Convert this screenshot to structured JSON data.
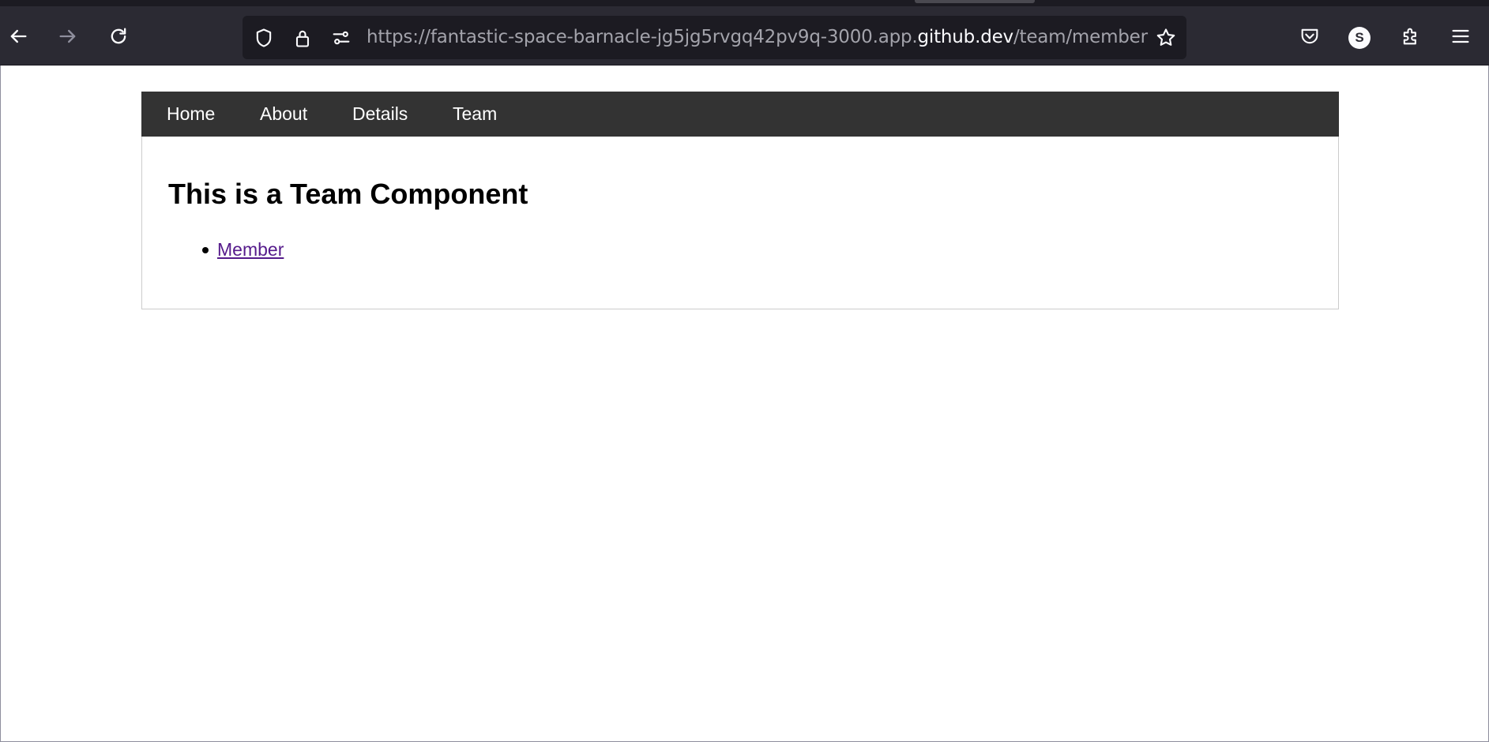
{
  "browser": {
    "url_prefix": "https://fantastic-space-barnacle-jg5jg5rvgq42pv9q-3000.app.",
    "url_domain": "github.dev",
    "url_path": "/team/member",
    "profile_initial": "S",
    "icons": {
      "back": "back-arrow-icon",
      "forward": "forward-arrow-icon",
      "reload": "reload-icon",
      "shield": "tracking-protection-shield-icon",
      "lock": "lock-icon",
      "permissions": "permissions-sliders-icon",
      "bookmark": "star-bookmark-icon",
      "pocket": "pocket-icon",
      "extensions": "puzzle-extensions-icon",
      "menu": "hamburger-menu-icon"
    }
  },
  "nav": {
    "items": [
      {
        "label": "Home"
      },
      {
        "label": "About"
      },
      {
        "label": "Details"
      },
      {
        "label": "Team"
      }
    ]
  },
  "main": {
    "title": "This is a Team Component",
    "members": [
      {
        "label": "Member"
      }
    ]
  },
  "colors": {
    "nav_bg": "#333333",
    "visited_link": "#551a8b",
    "toolbar_bg": "#2b2a33",
    "urlbar_bg": "#1c1b22"
  }
}
